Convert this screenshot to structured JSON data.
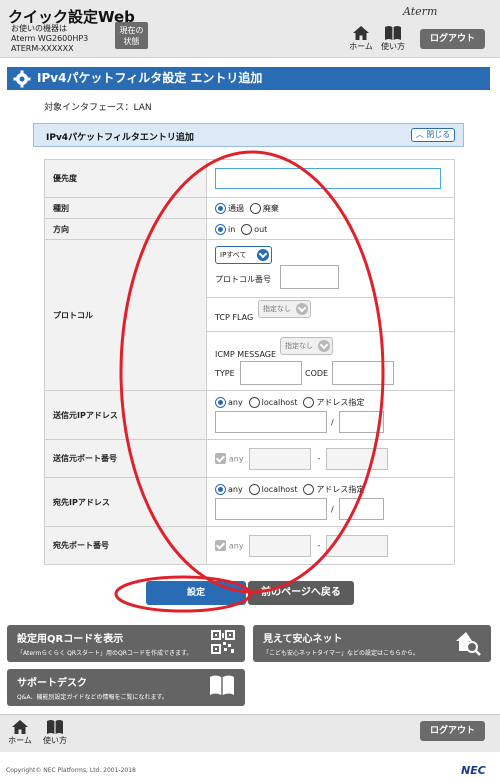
{
  "header": {
    "app_title": "クイック設定Web",
    "device_lines": [
      "お使いの機器は",
      "Aterm WG2600HP3",
      "ATERM-XXXXXX"
    ],
    "status_button": [
      "現在の",
      "状態"
    ],
    "brand": "Aterm",
    "home_label": "ホーム",
    "howto_label": "使い方",
    "logout_label": "ログアウト"
  },
  "page": {
    "title": "IPv4パケットフィルタ設定 エントリ追加",
    "interface_label": "対象インタフェース：LAN"
  },
  "section": {
    "title": "IPv4パケットフィルタエントリ追加",
    "close_label": "閉じる"
  },
  "form": {
    "priority": {
      "label": "優先度",
      "value": ""
    },
    "type": {
      "label": "種別",
      "options": [
        "通過",
        "廃棄"
      ],
      "selected": "通過"
    },
    "direction": {
      "label": "方向",
      "options": [
        "in",
        "out"
      ],
      "selected": "in"
    },
    "protocol": {
      "label": "プロトコル",
      "select_value": "IPすべて",
      "number_label": "プロトコル番号",
      "tcp_flag_label": "TCP FLAG",
      "tcp_flag_value": "指定なし",
      "icmp_label": "ICMP MESSAGE",
      "icmp_value": "指定なし",
      "type_label": "TYPE",
      "code_label": "CODE"
    },
    "src_ip": {
      "label": "送信元IPアドレス",
      "options": [
        "any",
        "localhost",
        "アドレス指定"
      ],
      "selected": "any",
      "slash": "/"
    },
    "src_port": {
      "label": "送信元ポート番号",
      "any_label": "any",
      "dash": "-"
    },
    "dst_ip": {
      "label": "宛先IPアドレス",
      "options": [
        "any",
        "localhost",
        "アドレス指定"
      ],
      "selected": "any",
      "slash": "/"
    },
    "dst_port": {
      "label": "宛先ポート番号",
      "any_label": "any",
      "dash": "-"
    }
  },
  "actions": {
    "set_label": "設定",
    "back_label": "前のページへ戻る"
  },
  "cards": [
    {
      "title": "設定用QRコードを表示",
      "subtitle": "「Atermらくらく QRスタート」用のQRコードを作成できます。",
      "icon": "qr-code-icon"
    },
    {
      "title": "見えて安心ネット",
      "subtitle": "「こども安心ネットタイマー」などの設定はこちらから。",
      "icon": "home-search-icon"
    },
    {
      "title": "サポートデスク",
      "subtitle": "Q&A、機能別設定ガイドなどの情報をご覧になれます。",
      "icon": "book-icon"
    }
  ],
  "footer": {
    "home_label": "ホーム",
    "howto_label": "使い方",
    "logout_label": "ログアウト",
    "copyright": "Copyright© NEC Platforms, Ltd. 2001-2018",
    "nec_logo": "NEC"
  },
  "colors": {
    "accent": "#2a6cb3",
    "annotation": "#e0202a",
    "card": "#646464"
  }
}
